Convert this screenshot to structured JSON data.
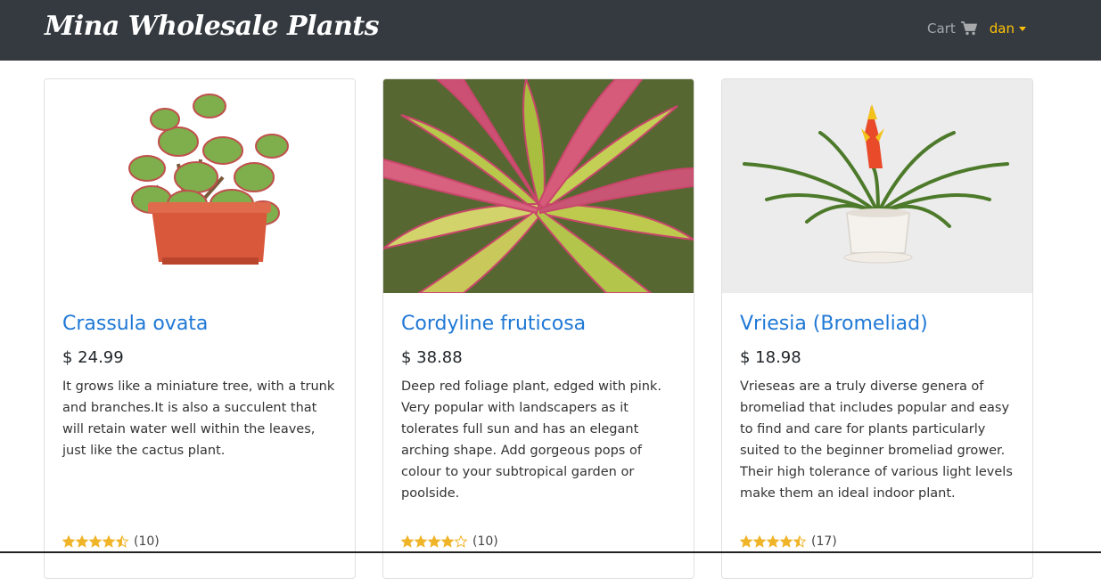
{
  "navbar": {
    "brand": "Mina Wholesale Plants",
    "cart_label": "Cart",
    "cart_icon": "shopping-cart-icon",
    "user_label": "dan",
    "colors": {
      "background": "#343a40",
      "user": "#ffc107",
      "cart": "#a7a9ab"
    }
  },
  "products": [
    {
      "name": "Crassula ovata",
      "price": "$ 24.99",
      "description": "It grows like a miniature tree, with a trunk and branches.It is also a succulent that will retain water well within the leaves, just like the cactus plant.",
      "rating": 4.5,
      "reviews": "(10)"
    },
    {
      "name": "Cordyline fruticosa",
      "price": "$ 38.88",
      "description": "Deep red foliage plant, edged with pink. Very popular with landscapers as it tolerates full sun and has an elegant arching shape. Add gorgeous pops of colour to your subtropical garden or poolside.",
      "rating": 4,
      "reviews": "(10)"
    },
    {
      "name": "Vriesia (Bromeliad)",
      "price": "$ 18.98",
      "description": "Vrieseas are a truly diverse genera of bromeliad that includes popular and easy to find and care for plants particularly suited to the beginner bromeliad grower. Their high tolerance of various light levels make them an ideal indoor plant.",
      "rating": 4.5,
      "reviews": "(17)"
    }
  ],
  "colors": {
    "title_link": "#1f78d6",
    "star": "#f0b429"
  }
}
